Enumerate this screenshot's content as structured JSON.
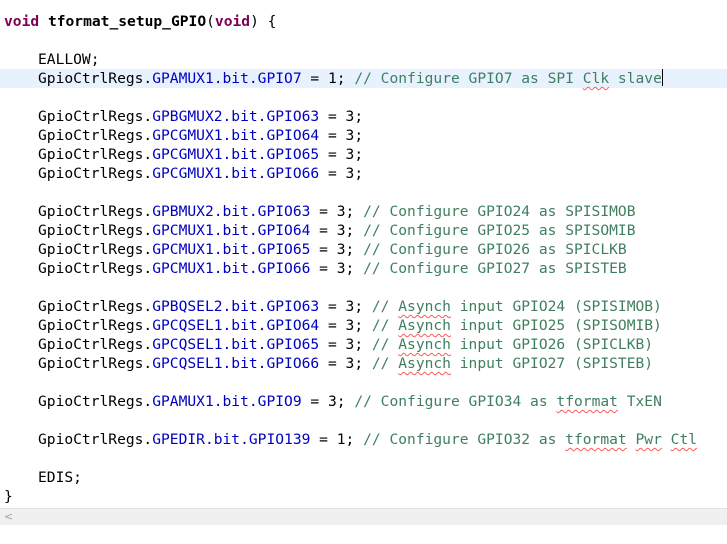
{
  "editor": {
    "signature": {
      "ret_type": "void",
      "name": "tformat_setup_GPIO",
      "open_paren": "(",
      "param_type": "void",
      "close": ") {"
    },
    "eallow": "EALLOW;",
    "current_line": {
      "prefix": "GpioCtrlRegs.",
      "field": "GPAMUX1.bit.GPIO7",
      "suffix": " = 1; ",
      "comment_a": "// Configure GPIO7 as SPI ",
      "comment_sq": "Clk",
      "comment_b": " slave"
    },
    "block_gmux": [
      {
        "field": "GPBGMUX2.bit.GPIO63",
        "suffix": " = 3;"
      },
      {
        "field": "GPCGMUX1.bit.GPIO64",
        "suffix": " = 3;"
      },
      {
        "field": "GPCGMUX1.bit.GPIO65",
        "suffix": " = 3;"
      },
      {
        "field": "GPCGMUX1.bit.GPIO66",
        "suffix": " = 3;"
      }
    ],
    "block_mux": [
      {
        "field": "GPBMUX2.bit.GPIO63",
        "suffix": " = 3; ",
        "comment": "// Configure GPIO24 as SPISIMOB"
      },
      {
        "field": "GPCMUX1.bit.GPIO64",
        "suffix": " = 3; ",
        "comment": "// Configure GPIO25 as SPISOMIB"
      },
      {
        "field": "GPCMUX1.bit.GPIO65",
        "suffix": " = 3; ",
        "comment": "// Configure GPIO26 as SPICLKB"
      },
      {
        "field": "GPCMUX1.bit.GPIO66",
        "suffix": " = 3; ",
        "comment": "// Configure GPIO27 as SPISTEB"
      }
    ],
    "block_qsel": [
      {
        "field": "GPBQSEL2.bit.GPIO63",
        "suffix": " = 3; ",
        "c1": "// ",
        "sq": "Asynch",
        "c2": " input GPIO24 (SPISIMOB)"
      },
      {
        "field": "GPCQSEL1.bit.GPIO64",
        "suffix": " = 3; ",
        "c1": "// ",
        "sq": "Asynch",
        "c2": " input GPIO25 (SPISOMIB)"
      },
      {
        "field": "GPCQSEL1.bit.GPIO65",
        "suffix": " = 3; ",
        "c1": "// ",
        "sq": "Asynch",
        "c2": " input GPIO26 (SPICLKB)"
      },
      {
        "field": "GPCQSEL1.bit.GPIO66",
        "suffix": " = 3; ",
        "c1": "// ",
        "sq": "Asynch",
        "c2": " input GPIO27 (SPISTEB)"
      }
    ],
    "line_gpio9": {
      "field": "GPAMUX1.bit.GPIO9",
      "suffix": " = 3; ",
      "c1": "// Configure GPIO34 as ",
      "sq": "tformat",
      "c2": " TxEN"
    },
    "line_gpio139": {
      "field": "GPEDIR.bit.GPIO139",
      "suffix": " = 1; ",
      "c1": "// Configure GPIO32 as ",
      "sq1": "tformat",
      "mid": " ",
      "sq2": "Pwr",
      "sp": " ",
      "sq3": "Ctl"
    },
    "prefix": "GpioCtrlRegs.",
    "edis": "EDIS;",
    "close_brace": "}"
  },
  "scrollbar": {
    "left_arrow": "<"
  }
}
